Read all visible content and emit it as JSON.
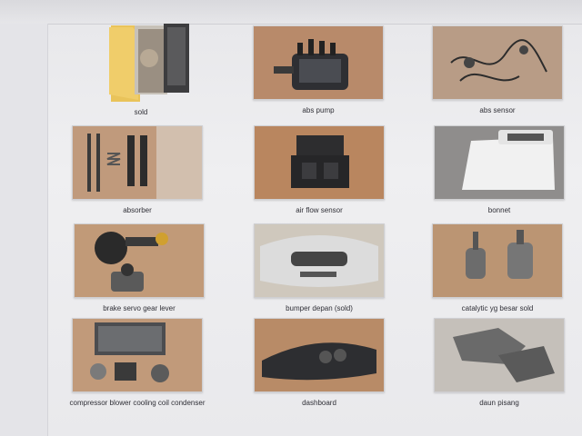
{
  "items": [
    {
      "label": "sold",
      "icon": "folder-icon"
    },
    {
      "label": "abs pump"
    },
    {
      "label": "abs sensor"
    },
    {
      "label": "absorber"
    },
    {
      "label": "air flow sensor"
    },
    {
      "label": "bonnet"
    },
    {
      "label": "brake servo gear lever"
    },
    {
      "label": "bumper depan (sold)"
    },
    {
      "label": "catalytic yg besar sold"
    },
    {
      "label": "compressor blower cooling coil condenser"
    },
    {
      "label": "dashboard"
    },
    {
      "label": "daun pisang"
    }
  ],
  "colors": {
    "folder": "#f0cd6a",
    "floor": "#b58a6c",
    "label_text": "#2f2f36"
  }
}
